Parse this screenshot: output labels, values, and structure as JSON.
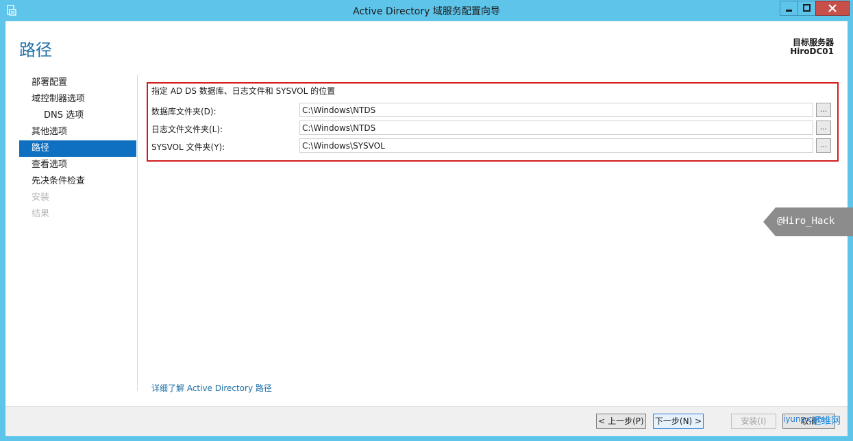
{
  "window": {
    "title": "Active Directory 域服务配置向导",
    "controls": [
      "minimize-icon",
      "maximize-icon",
      "close-icon"
    ]
  },
  "header": {
    "page_title": "路径",
    "target_server_label": "目标服务器",
    "target_server_name": "HiroDC01"
  },
  "nav": {
    "items": [
      {
        "label": "部署配置",
        "state": "normal"
      },
      {
        "label": "域控制器选项",
        "state": "normal"
      },
      {
        "label": "DNS 选项",
        "state": "sub"
      },
      {
        "label": "其他选项",
        "state": "normal"
      },
      {
        "label": "路径",
        "state": "active"
      },
      {
        "label": "查看选项",
        "state": "normal"
      },
      {
        "label": "先决条件检查",
        "state": "normal"
      },
      {
        "label": "安装",
        "state": "disabled"
      },
      {
        "label": "结果",
        "state": "disabled"
      }
    ]
  },
  "main": {
    "description": "指定 AD DS 数据库、日志文件和 SYSVOL 的位置",
    "fields": [
      {
        "label": "数据库文件夹(D):",
        "value": "C:\\Windows\\NTDS"
      },
      {
        "label": "日志文件文件夹(L):",
        "value": "C:\\Windows\\NTDS"
      },
      {
        "label": "SYSVOL 文件夹(Y):",
        "value": "C:\\Windows\\SYSVOL"
      }
    ],
    "browse_label": "...",
    "learn_more": "详细了解 Active Directory 路径"
  },
  "footer": {
    "prev": "< 上一步(P)",
    "next": "下一步(N) >",
    "install": "安装(I)",
    "cancel": "取消"
  },
  "watermark": {
    "text": "@Hiro_Hack",
    "site": "iyunv.com",
    "site_cn": "运维网"
  },
  "colors": {
    "accent": "#0f6fc0",
    "titlebar": "#5ec4ea",
    "highlight_box": "#d21b1b",
    "link": "#1e6fa8"
  }
}
